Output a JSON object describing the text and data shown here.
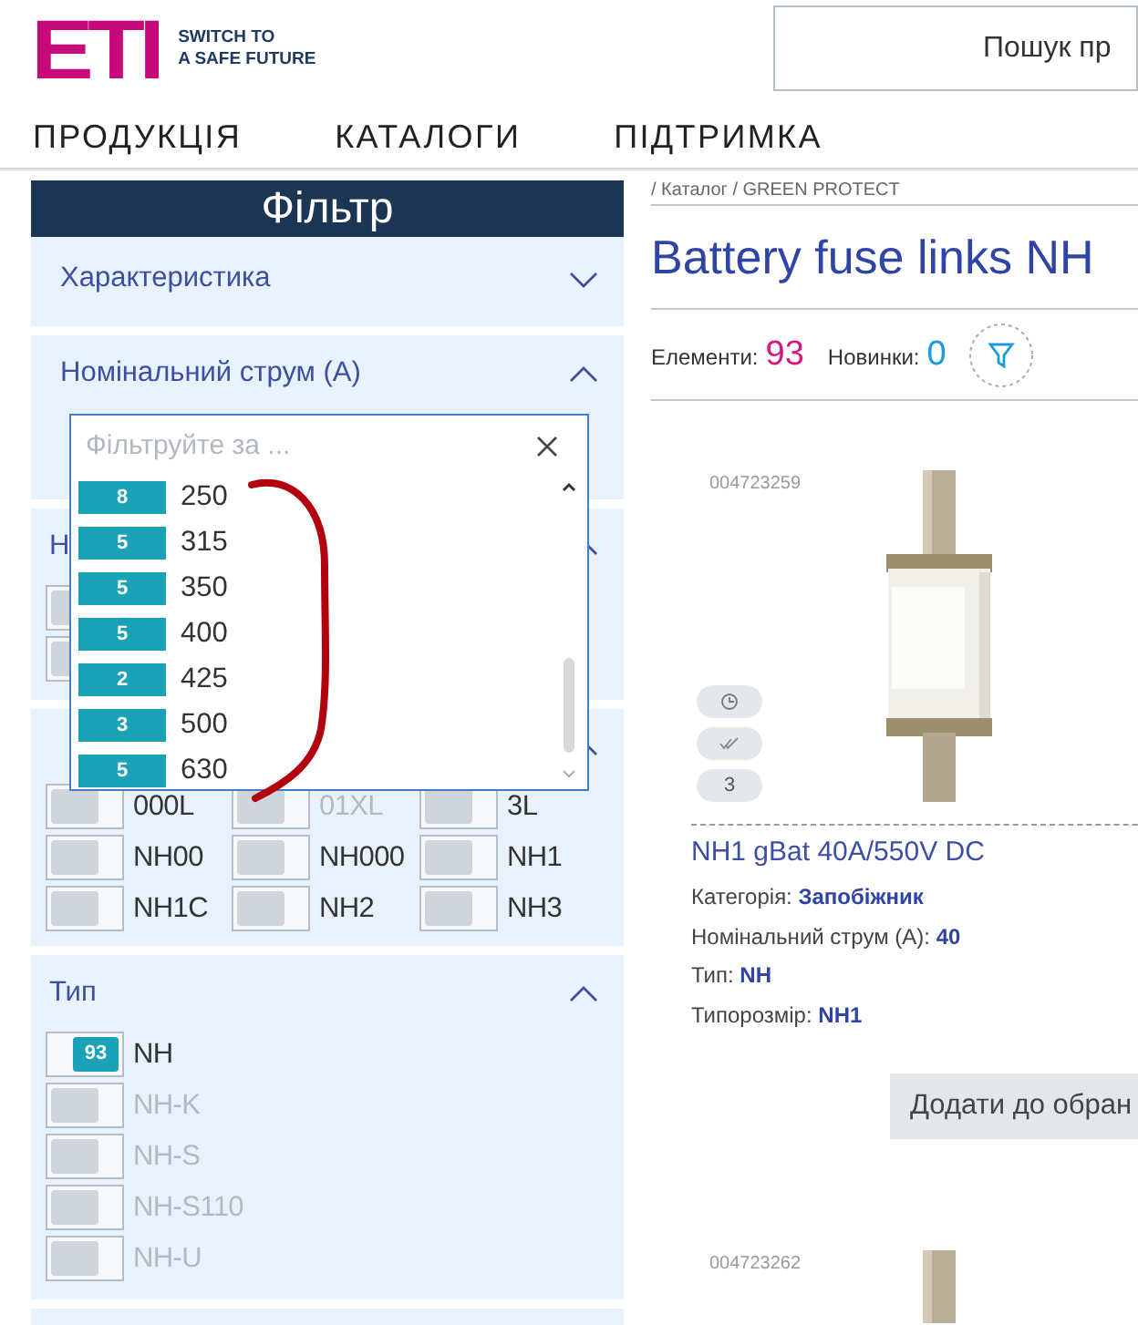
{
  "header": {
    "logo": "ETI",
    "tagline": [
      "SWITCH TO",
      "A SAFE FUTURE"
    ],
    "search": {
      "placeholder": "Пошук пр"
    }
  },
  "nav": [
    "ПРОДУКЦІЯ",
    "КАТАЛОГИ",
    "ПІДТРИМКА"
  ],
  "filter": {
    "title": "Фільтр",
    "sections": [
      {
        "kind": "plain",
        "title": "Характеристика",
        "expanded": false
      },
      {
        "kind": "dropdown",
        "title": "Номінальний струм (А)",
        "expanded": true,
        "dropdown": {
          "placeholder": "Фільтруйте за ...",
          "items": [
            {
              "count": "8",
              "value": "250"
            },
            {
              "count": "5",
              "value": "315"
            },
            {
              "count": "5",
              "value": "350"
            },
            {
              "count": "5",
              "value": "400"
            },
            {
              "count": "2",
              "value": "425"
            },
            {
              "count": "3",
              "value": "500"
            },
            {
              "count": "5",
              "value": "630"
            }
          ]
        }
      },
      {
        "kind": "list",
        "title": "Н",
        "expanded": true,
        "items": [
          {
            "checked": false
          },
          {
            "checked": false
          }
        ]
      },
      {
        "kind": "grid",
        "expanded": true,
        "items": [
          {
            "label": "000L",
            "checked": false,
            "disabled": false
          },
          {
            "label": "01XL",
            "checked": false,
            "disabled": true
          },
          {
            "label": "3L",
            "checked": false,
            "disabled": false
          },
          {
            "label": "NH00",
            "checked": false,
            "disabled": false
          },
          {
            "label": "NH000",
            "checked": false,
            "disabled": false
          },
          {
            "label": "NH1",
            "checked": false,
            "disabled": false
          },
          {
            "label": "NH1C",
            "checked": false,
            "disabled": false
          },
          {
            "label": "NH2",
            "checked": false,
            "disabled": false
          },
          {
            "label": "NH3",
            "checked": false,
            "disabled": false
          }
        ]
      },
      {
        "kind": "list",
        "title": "Тип",
        "expanded": true,
        "items": [
          {
            "label": "NH",
            "count": "93",
            "checked": true,
            "disabled": false
          },
          {
            "label": "NH-K",
            "checked": false,
            "disabled": true
          },
          {
            "label": "NH-S",
            "checked": false,
            "disabled": true
          },
          {
            "label": "NH-S110",
            "checked": false,
            "disabled": true
          },
          {
            "label": "NH-U",
            "checked": false,
            "disabled": true
          }
        ]
      }
    ]
  },
  "breadcrumb": "/ Каталог / GREEN PROTECT",
  "title": "Battery fuse links NH",
  "stats": [
    {
      "label": "Елементи:",
      "value": "93",
      "color": "#d6177e"
    },
    {
      "label": "Новинки:",
      "value": "0",
      "color": "#1b9bd7"
    }
  ],
  "products": [
    {
      "code": "004723259",
      "badge": "3",
      "name": "NH1 gBat 40A/550V DC",
      "attributes": [
        "Категорія: **Запобіжник**",
        "Номінальний струм (А): **40**",
        "Тип: **NH**",
        "Типорозмір: **NH1**"
      ],
      "button": "Додати до обран"
    },
    {
      "code": "004723262"
    }
  ]
}
